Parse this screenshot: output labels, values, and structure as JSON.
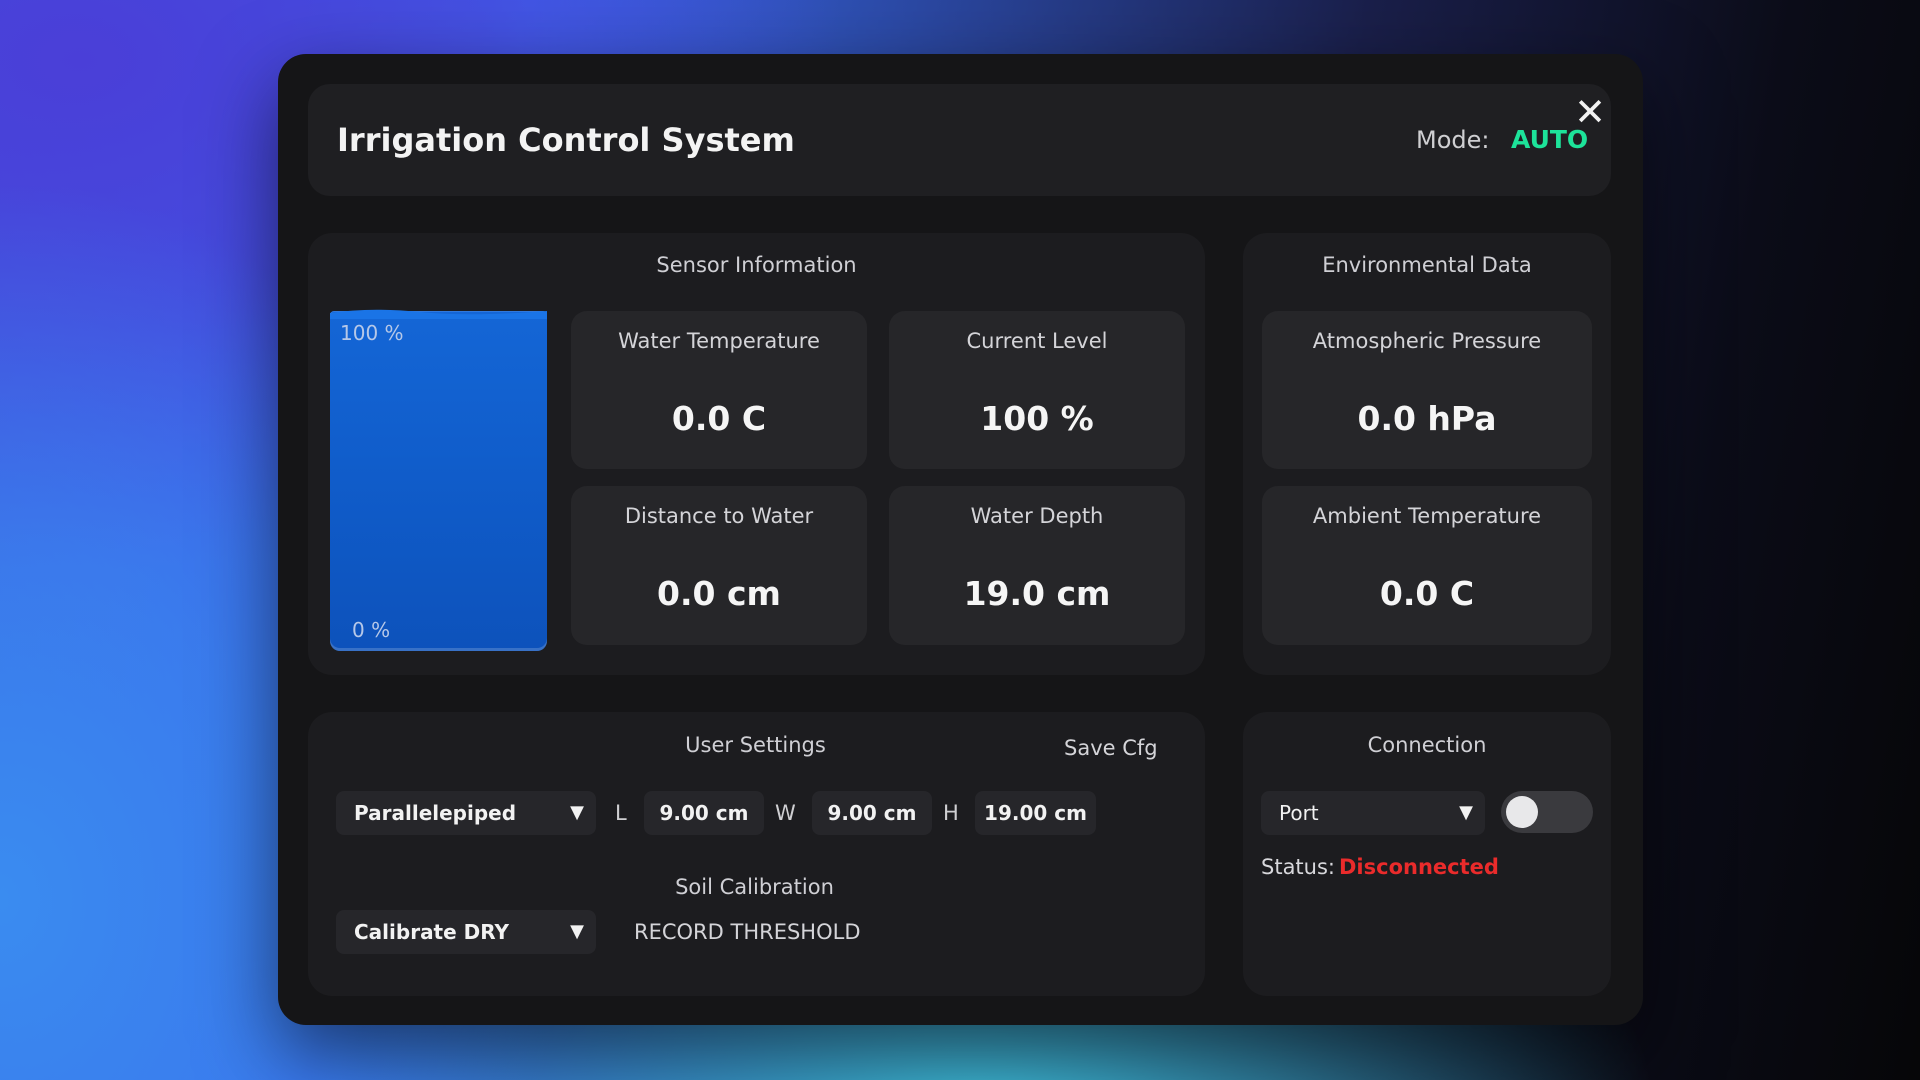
{
  "header": {
    "title": "Irrigation Control System",
    "mode_label": "Mode:",
    "mode_value": "AUTO",
    "close_glyph": "✕"
  },
  "sensor": {
    "title": "Sensor Information",
    "tank": {
      "top_label": "100 %",
      "bottom_label": "0 %",
      "fill_percent": 100
    },
    "cards": [
      {
        "label": "Water Temperature",
        "value": "0.0 C"
      },
      {
        "label": "Current Level",
        "value": "100 %"
      },
      {
        "label": "Distance to Water",
        "value": "0.0 cm"
      },
      {
        "label": "Water Depth",
        "value": "19.0 cm"
      }
    ]
  },
  "environment": {
    "title": "Environmental Data",
    "cards": [
      {
        "label": "Atmospheric Pressure",
        "value": "0.0 hPa"
      },
      {
        "label": "Ambient Temperature",
        "value": "0.0 C"
      }
    ]
  },
  "settings": {
    "title": "User Settings",
    "save_label": "Save Cfg",
    "shape_select": "Parallelepiped",
    "length_label": "L",
    "length_value": "9.00 cm",
    "width_label": "W",
    "width_value": "9.00 cm",
    "height_label": "H",
    "height_value": "19.00 cm",
    "soil_title": "Soil Calibration",
    "calibrate_select": "Calibrate DRY",
    "record_label": "RECORD THRESHOLD",
    "arrow_glyph": "▼"
  },
  "connection": {
    "title": "Connection",
    "port_select": "Port",
    "toggle_on": false,
    "status_label": "Status:",
    "status_value": "Disconnected"
  },
  "colors": {
    "accent_auto": "#1de39a",
    "status_error": "#ea2b2b",
    "tank_blue": "#1466d6"
  }
}
